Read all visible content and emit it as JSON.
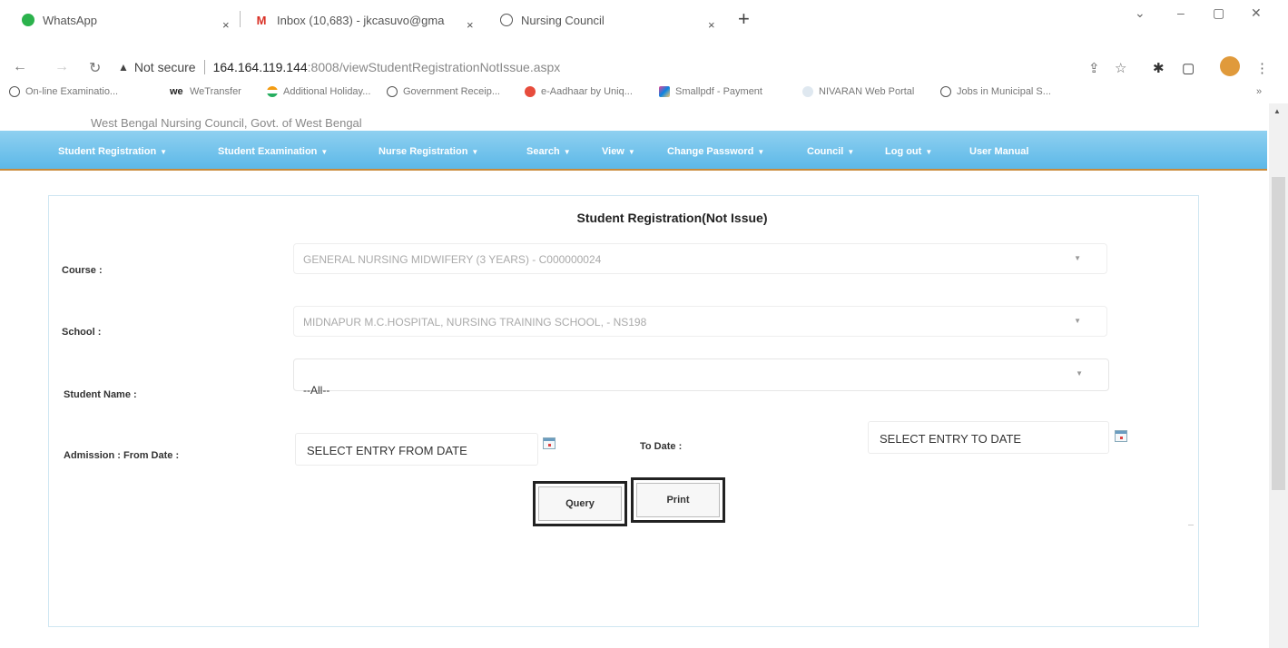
{
  "browser": {
    "tabs": [
      {
        "title": "WhatsApp",
        "close": "×"
      },
      {
        "title": "Inbox (10,683) - jkcasuvo@gma",
        "close": "×"
      },
      {
        "title": "Nursing Council",
        "close": "×"
      }
    ],
    "new_tab": "+",
    "window_controls": [
      "⌄",
      "–",
      "▢",
      "✕"
    ],
    "address": {
      "security": "Not secure",
      "host": "164.164.119.144",
      "path": ":8008/viewStudentRegistrationNotIssue.aspx"
    },
    "bookmarks": [
      "On-line Examinatio...",
      "WeTransfer",
      "Additional Holiday...",
      "Government Receip...",
      "e-Aadhaar by Uniq...",
      "Smallpdf - Payment",
      "NIVARAN Web Portal",
      "Jobs in Municipal S..."
    ],
    "bookmarks_more": "»"
  },
  "site": {
    "header_partial": "West Bengal Nursing Council, Govt. of West Bengal",
    "menu": [
      {
        "label": "Student Registration",
        "caret": "▼"
      },
      {
        "label": "Student Examination",
        "caret": "▼"
      },
      {
        "label": "Nurse Registration",
        "caret": "▼"
      },
      {
        "label": "Search",
        "caret": "▼"
      },
      {
        "label": "View",
        "caret": "▼"
      },
      {
        "label": "Change Password",
        "caret": "▼"
      },
      {
        "label": "Council",
        "caret": "▼"
      },
      {
        "label": "Log out",
        "caret": "▼"
      },
      {
        "label": "User Manual",
        "caret": ""
      }
    ]
  },
  "form": {
    "title": "Student Registration(Not Issue)",
    "course_label": "Course :",
    "course_value": "GENERAL NURSING MIDWIFERY (3 YEARS) - C000000024",
    "school_label": "School :",
    "school_value": "MIDNAPUR M.C.HOSPITAL, NURSING TRAINING SCHOOL, - NS198",
    "student_label": "Student Name :",
    "student_value": "--All--",
    "from_label": "Admission : From Date :",
    "from_placeholder": "SELECT ENTRY FROM DATE",
    "to_label": "To Date :",
    "to_placeholder": "SELECT ENTRY TO DATE",
    "query_button": "Query",
    "print_button": "Print"
  }
}
